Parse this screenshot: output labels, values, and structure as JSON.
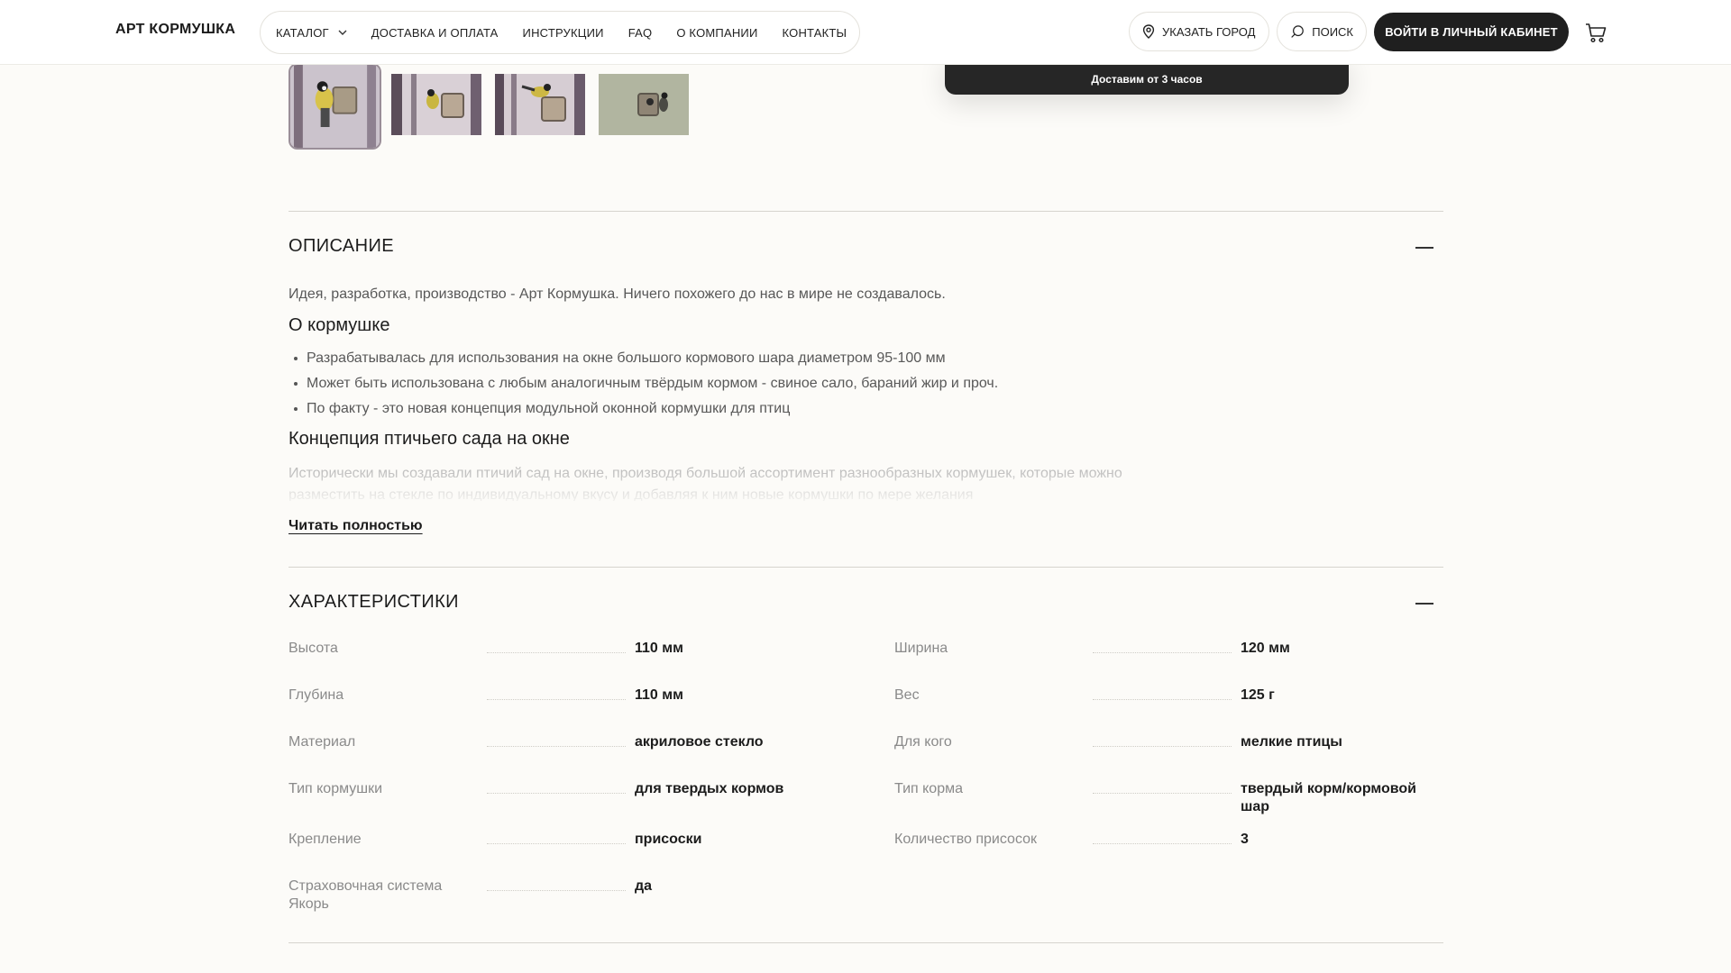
{
  "header": {
    "logo": "АРТ КОРМУШКА",
    "nav": [
      {
        "label": "КАТАЛОГ",
        "has_dropdown": true
      },
      {
        "label": "ДОСТАВКА И ОПЛАТА"
      },
      {
        "label": "ИНСТРУКЦИИ"
      },
      {
        "label": "FAQ"
      },
      {
        "label": "О КОМПАНИИ"
      },
      {
        "label": "КОНТАКТЫ"
      }
    ],
    "city_label": "УКАЗАТЬ ГОРОД",
    "search_label": "ПОИСК",
    "login_label": "ВОЙТИ В ЛИЧНЫЙ КАБИНЕТ",
    "icons": {
      "city": "location-pin-icon",
      "search": "search-icon",
      "cart": "cart-icon",
      "dropdown": "chevron-down-icon"
    }
  },
  "delivery_panel": {
    "text": "Доставим от 3 часов"
  },
  "gallery": {
    "thumbnail_count": 4,
    "active_index": 0
  },
  "description": {
    "title": "ОПИСАНИЕ",
    "intro": "Идея, разработка, производство - Арт Кормушка. Ничего похожего до нас в мире не создавалось.",
    "heading_about": "О кормушке",
    "bullets": [
      "Разрабатывалась для использования на окне большого кормового шара диаметром 95-100 мм",
      "Может быть использована с любым аналогичным твёрдым кормом - свиное сало, бараний жир и проч.",
      "По факту - это новая концепция модульной оконной кормушки для птиц"
    ],
    "heading_concept": "Концепция птичьего сада на окне",
    "concept_text": "Исторически мы создавали птичий сад на окне, производя большой ассортимент разнообразных кормушек, которые можно разместить на стекле по индивидуальному вкусу и добавляя к ним новые кормушки по мере желания",
    "read_more": "Читать полностью"
  },
  "characteristics": {
    "title": "ХАРАКТЕРИСТИКИ",
    "left": [
      {
        "label": "Высота",
        "value": "110 мм"
      },
      {
        "label": "Глубина",
        "value": "110 мм"
      },
      {
        "label": "Материал",
        "value": "акриловое стекло"
      },
      {
        "label": "Тип кормушки",
        "value": "для твердых кормов"
      },
      {
        "label": "Крепление",
        "value": "присоски"
      },
      {
        "label": "Страховочная система Якорь",
        "value": "да"
      }
    ],
    "right": [
      {
        "label": "Ширина",
        "value": "120 мм"
      },
      {
        "label": "Вес",
        "value": "125 г"
      },
      {
        "label": "Для кого",
        "value": "мелкие птицы"
      },
      {
        "label": "Тип корма",
        "value": "твердый корм/кормовой шар"
      },
      {
        "label": "Количество присосок",
        "value": "3"
      }
    ]
  },
  "colors": {
    "background": "#fcfbf8",
    "dark": "#1f1f1f",
    "muted_text": "#8a8a8a"
  }
}
